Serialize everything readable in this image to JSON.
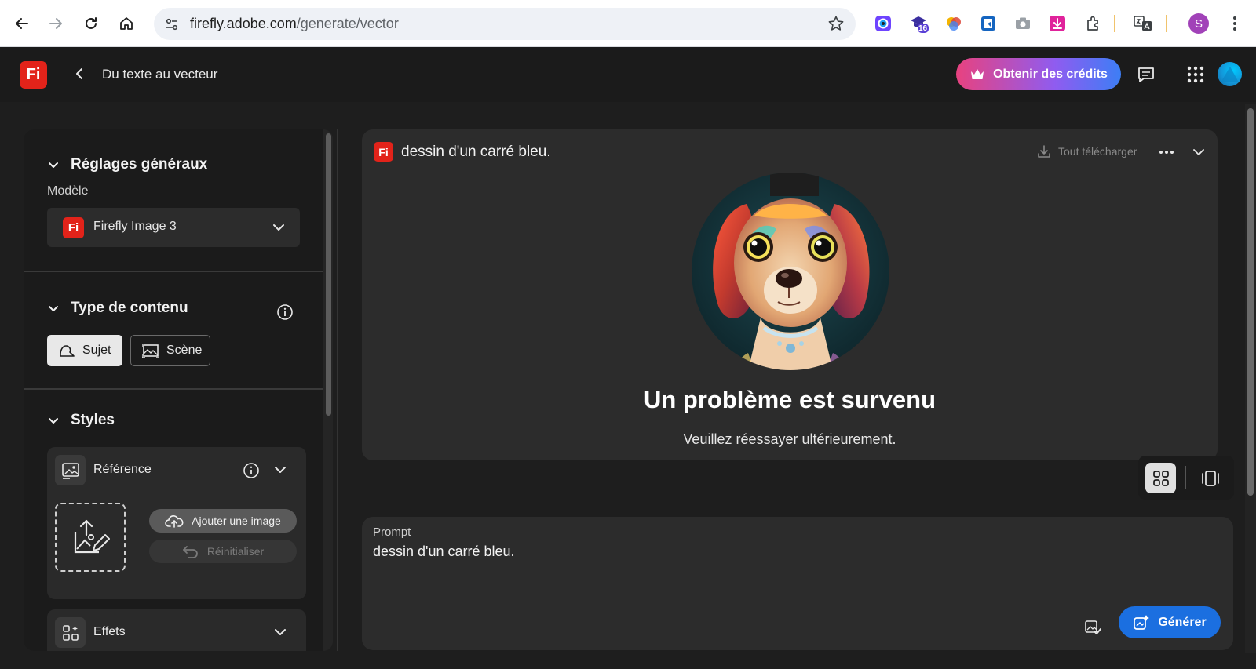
{
  "browser": {
    "url_domain": "firefly.adobe.com",
    "url_path": "/generate/vector",
    "extension_badge": "16",
    "profile_initial": "S"
  },
  "header": {
    "logo_text": "Fi",
    "title": "Du texte au vecteur",
    "credits_label": "Obtenir des crédits"
  },
  "sidebar": {
    "general": {
      "heading": "Réglages généraux",
      "model_label": "Modèle",
      "model_logo": "Fi",
      "model_value": "Firefly Image 3"
    },
    "content_type": {
      "heading": "Type de contenu",
      "options": [
        {
          "label": "Sujet",
          "selected": true
        },
        {
          "label": "Scène",
          "selected": false
        }
      ]
    },
    "styles": {
      "heading": "Styles",
      "reference": {
        "title": "Référence",
        "add_image": "Ajouter une image",
        "reset": "Réinitialiser"
      },
      "effects": {
        "title": "Effets"
      }
    }
  },
  "result": {
    "logo_text": "Fi",
    "prompt": "dessin d'un carré bleu.",
    "download_all": "Tout télécharger",
    "error_title": "Un problème est survenu",
    "error_subtitle": "Veuillez réessayer ultérieurement."
  },
  "prompt_box": {
    "label": "Prompt",
    "value": "dessin d'un carré bleu.",
    "generate_label": "Générer"
  },
  "colors": {
    "brand_red": "#e2231a",
    "generate_blue": "#1b6fe0",
    "credits_gradient": [
      "#e8427f",
      "#8f5cf0",
      "#3d7ef5"
    ],
    "panel_bg": "#2c2c2c",
    "app_bg": "#1e1e1e"
  },
  "icons": [
    "back-arrow-icon",
    "forward-arrow-icon",
    "reload-icon",
    "home-icon",
    "site-info-icon",
    "star-icon",
    "extensions-icon",
    "translate-icon",
    "kebab-menu-icon",
    "chevron-left-icon",
    "crown-icon",
    "feedback-icon",
    "apps-grid-icon",
    "chevron-down-icon",
    "info-icon",
    "subject-shape-icon",
    "scene-icon",
    "reference-image-icon",
    "upload-image-icon",
    "cloud-upload-icon",
    "undo-icon",
    "effects-icon",
    "download-icon",
    "more-icon",
    "grid-view-icon",
    "single-view-icon",
    "style-picker-icon",
    "generate-sparkle-icon"
  ]
}
